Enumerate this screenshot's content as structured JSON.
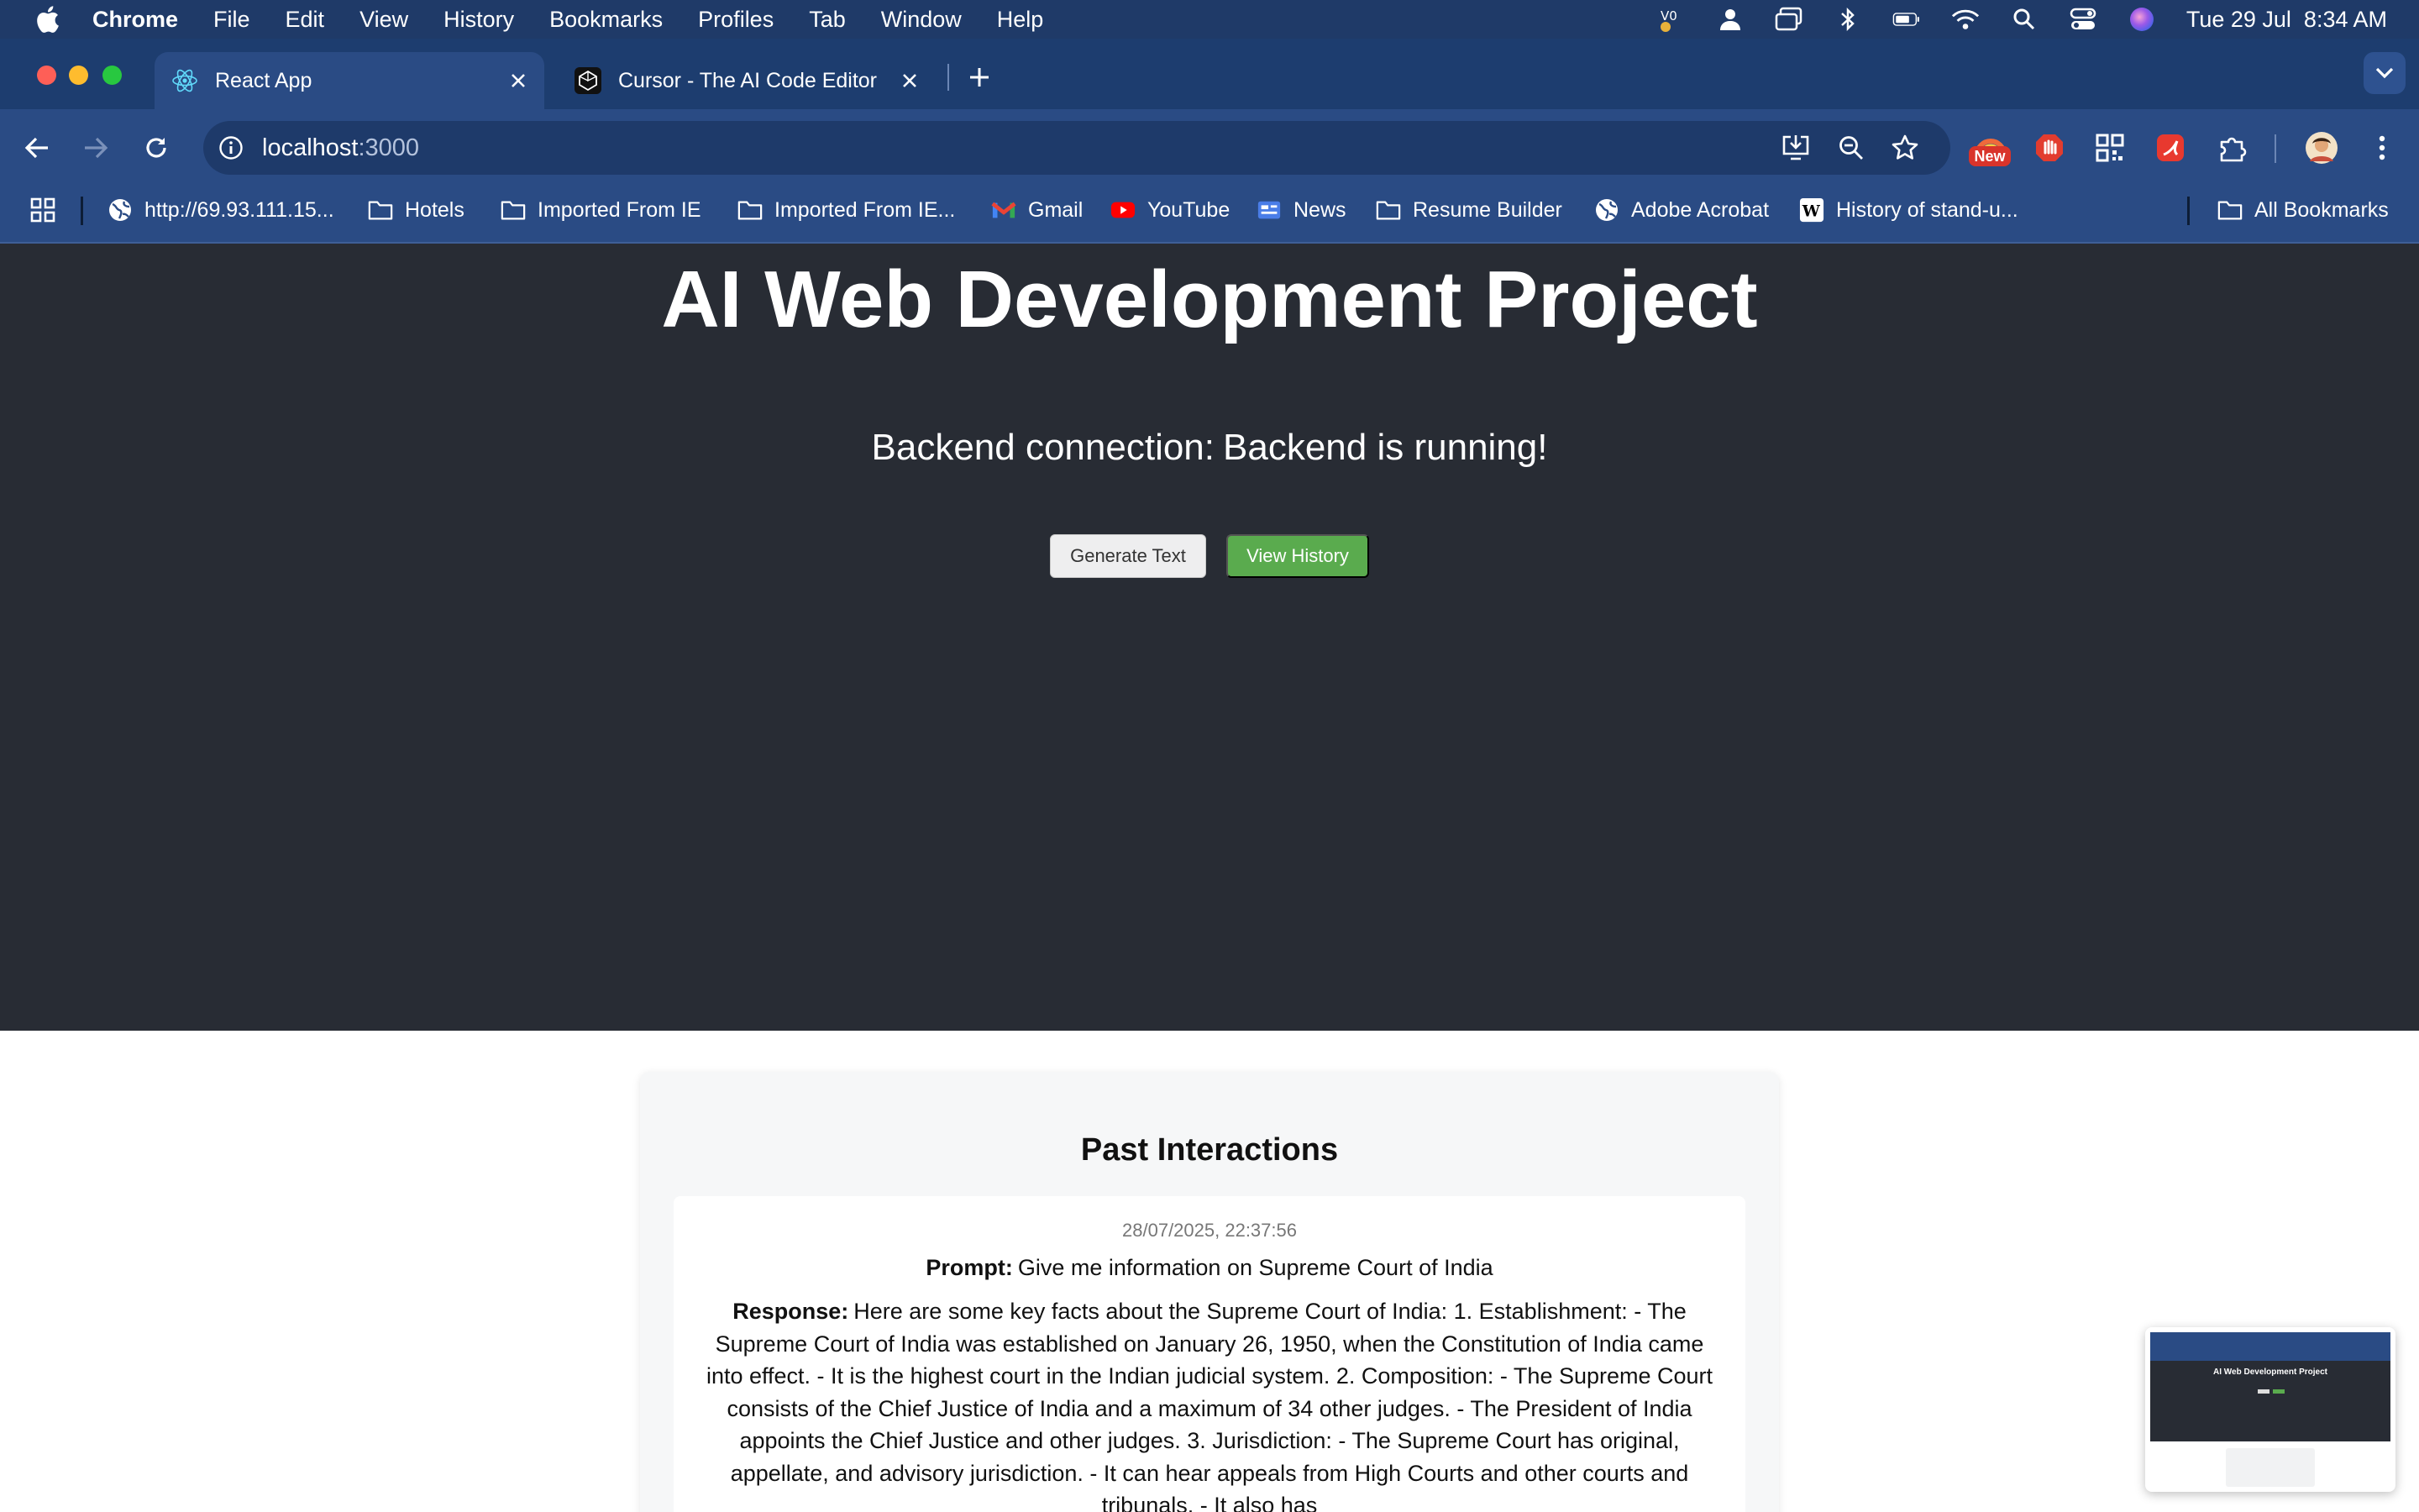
{
  "menubar": {
    "app": "Chrome",
    "items": [
      "File",
      "Edit",
      "View",
      "History",
      "Bookmarks",
      "Profiles",
      "Tab",
      "Window",
      "Help"
    ],
    "clock": "Tue 29 Jul  8:34 AM"
  },
  "tabs": [
    {
      "title": "React App",
      "icon": "react-icon"
    },
    {
      "title": "Cursor - The AI Code Editor",
      "icon": "cursor-icon"
    }
  ],
  "toolbar": {
    "url_host": "localhost",
    "url_port": ":3000",
    "extension_badge": "New"
  },
  "bookmarks": {
    "items": [
      {
        "label": "http://69.93.111.15...",
        "icon": "globe-icon"
      },
      {
        "label": "Hotels",
        "icon": "folder-icon"
      },
      {
        "label": "Imported From IE",
        "icon": "folder-icon"
      },
      {
        "label": "Imported From IE...",
        "icon": "folder-icon"
      },
      {
        "label": "Gmail",
        "icon": "gmail-icon"
      },
      {
        "label": "YouTube",
        "icon": "youtube-icon"
      },
      {
        "label": "News",
        "icon": "news-icon"
      },
      {
        "label": "Resume Builder",
        "icon": "folder-icon"
      },
      {
        "label": "Adobe Acrobat",
        "icon": "globe-icon"
      },
      {
        "label": "History of stand-u...",
        "icon": "wikipedia-icon"
      }
    ],
    "all_label": "All Bookmarks"
  },
  "page": {
    "title": "AI Web Development Project",
    "status_label": "Backend connection:",
    "status_value": "Backend is running!",
    "generate_button": "Generate Text",
    "history_button": "View History",
    "history": {
      "heading": "Past Interactions",
      "entries": [
        {
          "timestamp": "28/07/2025, 22:37:56",
          "prompt_label": "Prompt:",
          "prompt": "Give me information on Supreme Court of India",
          "response_label": "Response:",
          "response": "Here are some key facts about the Supreme Court of India: 1. Establishment: - The Supreme Court of India was established on January 26, 1950, when the Constitution of India came into effect. - It is the highest court in the Indian judicial system. 2. Composition: - The Supreme Court consists of the Chief Justice of India and a maximum of 34 other judges. - The President of India appoints the Chief Justice and other judges. 3. Jurisdiction: - The Supreme Court has original, appellate, and advisory jurisdiction. - It can hear appeals from High Courts and other courts and tribunals. - It also has"
        }
      ]
    }
  },
  "thumbnail": {
    "title": "AI Web Development Project"
  },
  "colors": {
    "hero_bg": "#282c34",
    "chrome_blue": "#2a4b84",
    "view_history_green": "#5aab4e"
  }
}
